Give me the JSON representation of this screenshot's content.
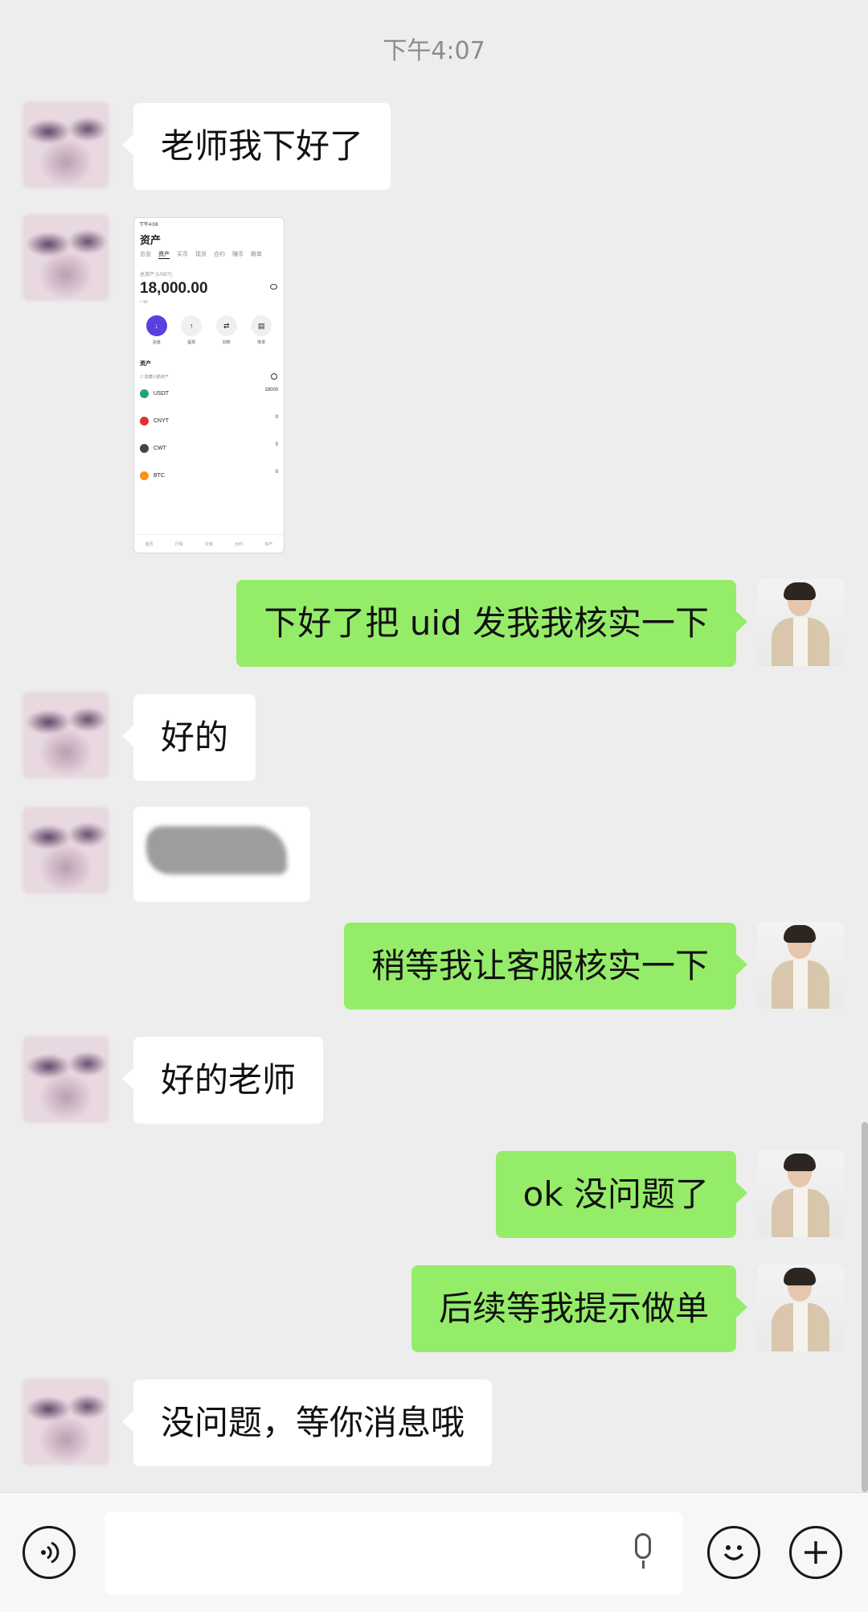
{
  "chat": {
    "timestamp": "下午4:07",
    "messages": [
      {
        "side": "left",
        "type": "text",
        "text": "老师我下好了"
      },
      {
        "side": "left",
        "type": "image",
        "image_desc": "screenshot"
      },
      {
        "side": "right",
        "type": "text",
        "text": "下好了把 uid 发我我核实一下"
      },
      {
        "side": "left",
        "type": "text",
        "text": "好的"
      },
      {
        "side": "left",
        "type": "image",
        "image_desc": "blurred"
      },
      {
        "side": "right",
        "type": "text",
        "text": "稍等我让客服核实一下"
      },
      {
        "side": "left",
        "type": "text",
        "text": "好的老师"
      },
      {
        "side": "right",
        "type": "text",
        "text": "ok 没问题了"
      },
      {
        "side": "right",
        "type": "text",
        "text": "后续等我提示做单"
      },
      {
        "side": "left",
        "type": "text",
        "text": "没问题，等你消息哦"
      }
    ]
  },
  "shared_screenshot": {
    "status": "下午4:08",
    "title": "资产",
    "tabs": [
      "总览",
      "资产",
      "买币",
      "现货",
      "合约",
      "赚币",
      "跟单"
    ],
    "active_tab": "资产",
    "balance_label": "总资产 (USDT)",
    "balance": "18,000.00",
    "balance_sub": "≈ ¥0",
    "actions": [
      "充值",
      "提现",
      "划转",
      "账单"
    ],
    "section": "资产",
    "hide_small": "隐藏小额资产",
    "coins": [
      {
        "name": "USDT",
        "amount": "18000",
        "color": "#26a17b"
      },
      {
        "name": "CNYT",
        "amount": "0",
        "color": "#e03131"
      },
      {
        "name": "CWT",
        "amount": "0",
        "color": "#444444"
      },
      {
        "name": "BTC",
        "amount": "0",
        "color": "#f7931a"
      }
    ],
    "nav": [
      "首页",
      "行情",
      "交易",
      "合约",
      "资产"
    ]
  },
  "colors": {
    "background": "#ededed",
    "sent_bubble": "#95ec69",
    "received_bubble": "#ffffff"
  },
  "input_bar": {
    "voice_icon": "voice-icon",
    "emoji_icon": "emoji-icon",
    "plus_icon": "plus-icon",
    "mic_icon": "mic-icon"
  }
}
